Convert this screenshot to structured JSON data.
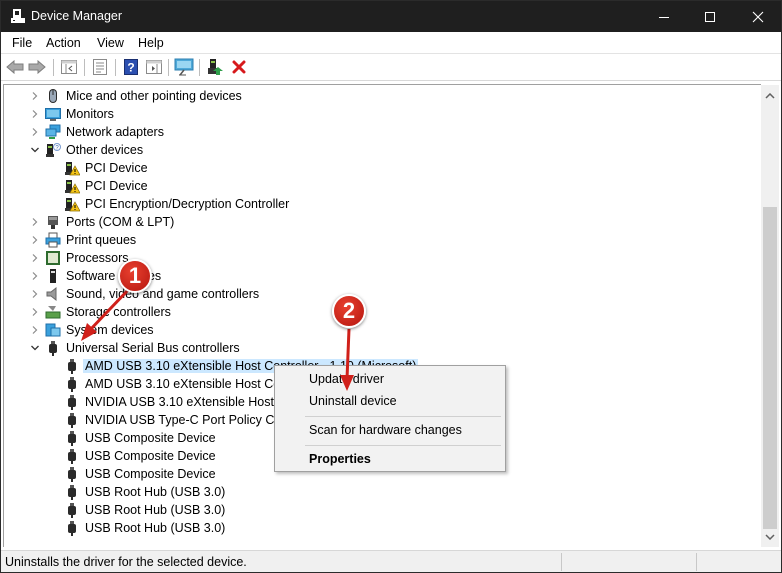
{
  "window": {
    "title": "Device Manager",
    "controls": {
      "minimize": "minimize",
      "maximize": "maximize",
      "close": "close"
    }
  },
  "menubar": {
    "items": [
      "File",
      "Action",
      "View",
      "Help"
    ]
  },
  "toolbar": {
    "buttons": [
      {
        "name": "back-icon"
      },
      {
        "name": "forward-icon"
      },
      {
        "name": "show-hide-console-tree-icon"
      },
      {
        "name": "properties-icon"
      },
      {
        "name": "help-icon"
      },
      {
        "name": "show-action-pane-icon"
      },
      {
        "name": "scan-hardware-icon"
      },
      {
        "name": "update-driver-icon"
      },
      {
        "name": "uninstall-icon"
      }
    ]
  },
  "tree": {
    "categories": [
      {
        "label": "Mice and other pointing devices",
        "expanded": false,
        "icon": "mouse-icon"
      },
      {
        "label": "Monitors",
        "expanded": false,
        "icon": "monitor-icon"
      },
      {
        "label": "Network adapters",
        "expanded": false,
        "icon": "network-icon"
      },
      {
        "label": "Other devices",
        "expanded": true,
        "icon": "unknown-device-icon",
        "children": [
          "PCI Device",
          "PCI Device",
          "PCI Encryption/Decryption Controller"
        ]
      },
      {
        "label": "Ports (COM & LPT)",
        "expanded": false,
        "icon": "port-icon"
      },
      {
        "label": "Print queues",
        "expanded": false,
        "icon": "printer-icon"
      },
      {
        "label": "Processors",
        "expanded": false,
        "icon": "processor-icon"
      },
      {
        "label": "Software devices",
        "expanded": false,
        "icon": "software-device-icon"
      },
      {
        "label": "Sound, video and game controllers",
        "expanded": false,
        "icon": "speaker-icon"
      },
      {
        "label": "Storage controllers",
        "expanded": false,
        "icon": "storage-icon"
      },
      {
        "label": "System devices",
        "expanded": false,
        "icon": "system-icon"
      },
      {
        "label": "Universal Serial Bus controllers",
        "expanded": true,
        "icon": "usb-icon",
        "children": [
          "AMD USB 3.10 eXtensible Host Controller - 1.10 (Microsoft)",
          "AMD USB 3.10 eXtensible Host Controller - 1.10 (Microsoft)",
          "NVIDIA USB 3.10 eXtensible Host Controller - 1.10 (Microsoft)",
          "NVIDIA USB Type-C Port Policy Controller",
          "USB Composite Device",
          "USB Composite Device",
          "USB Composite Device",
          "USB Root Hub (USB 3.0)",
          "USB Root Hub (USB 3.0)",
          "USB Root Hub (USB 3.0)"
        ]
      }
    ],
    "selected": "AMD USB 3.10 eXtensible Host Controller - 1.10 (Microsoft)"
  },
  "context_menu": {
    "items": [
      {
        "label": "Update driver",
        "bold": false
      },
      {
        "label": "Uninstall device",
        "bold": false
      },
      {
        "separator": true
      },
      {
        "label": "Scan for hardware changes",
        "bold": false
      },
      {
        "separator": true
      },
      {
        "label": "Properties",
        "bold": true
      }
    ]
  },
  "statusbar": {
    "text": "Uninstalls the driver for the selected device."
  },
  "annotations": {
    "badges": [
      "1",
      "2"
    ],
    "color": "#d0201a"
  }
}
